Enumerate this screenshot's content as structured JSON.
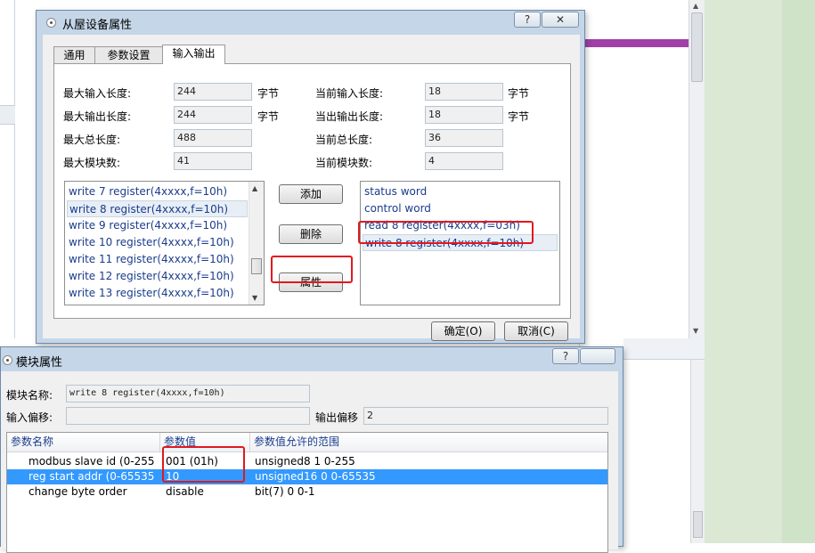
{
  "slave_dialog": {
    "title": "从屋设备属性",
    "help_label": "?",
    "close_label": "✕",
    "tabs": [
      "通用",
      "参数设置",
      "输入输出"
    ],
    "fields": {
      "max_input_len": {
        "label": "最大输入长度:",
        "value": "244",
        "unit": "字节"
      },
      "max_output_len": {
        "label": "最大输出长度:",
        "value": "244",
        "unit": "字节"
      },
      "max_total_len": {
        "label": "最大总长度:",
        "value": "488"
      },
      "max_modules": {
        "label": "最大模块数:",
        "value": "41"
      },
      "cur_input_len": {
        "label": "当前输入长度:",
        "value": "18",
        "unit": "字节"
      },
      "cur_output_len": {
        "label": "当出输出长度:",
        "value": "18",
        "unit": "字节"
      },
      "cur_total_len": {
        "label": "当前总长度:",
        "value": "36"
      },
      "cur_modules": {
        "label": "当前模块数:",
        "value": "4"
      }
    },
    "available_modules": [
      "write 7 register(4xxxx,f=10h)",
      "write 8 register(4xxxx,f=10h)",
      "write 9 register(4xxxx,f=10h)",
      "write 10 register(4xxxx,f=10h)",
      "write 11 register(4xxxx,f=10h)",
      "write 12 register(4xxxx,f=10h)",
      "write 13 register(4xxxx,f=10h)"
    ],
    "configured_modules": [
      "status word",
      "control word",
      "read 8 register(4xxxx,f=03h)",
      "write 8 register(4xxxx,f=10h)"
    ],
    "buttons": {
      "add": "添加",
      "delete": "删除",
      "properties": "属性",
      "ok": "确定(O)",
      "cancel": "取消(C)"
    }
  },
  "module_dialog": {
    "title": "模块属性",
    "help_label": "?",
    "module_name_label": "模块名称:",
    "module_name_value": "write 8 register(4xxxx,f=10h)",
    "input_offset_label": "输入偏移:",
    "input_offset_value": "",
    "output_offset_label": "输出偏移",
    "output_offset_value": "2",
    "columns": [
      "参数名称",
      "参数值",
      "参数值允许的范围"
    ],
    "rows": [
      {
        "name": "modbus slave id (0-255",
        "value": "001 (01h)",
        "range": "unsigned8 1 0-255"
      },
      {
        "name": "reg start addr (0-65535",
        "value": "10",
        "range": "unsigned16 0 0-65535"
      },
      {
        "name": "change byte order",
        "value": "disable",
        "range": "bit(7) 0 0-1"
      }
    ]
  },
  "colors": {
    "highlight": "#e0191f",
    "selection": "#3399ff",
    "accent_bar": "#a040a8"
  }
}
